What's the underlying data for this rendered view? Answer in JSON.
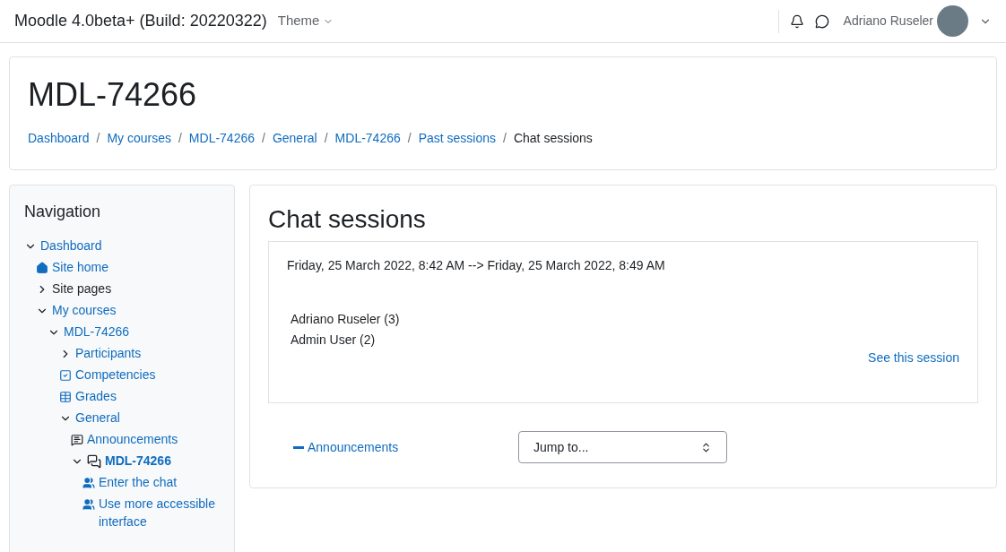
{
  "navbar": {
    "site_name": "Moodle 4.0beta+ (Build: 20220322)",
    "theme_menu": "Theme",
    "user_name": "Adriano Ruseler"
  },
  "header": {
    "title": "MDL-74266",
    "separator": "/",
    "breadcrumbs": [
      {
        "label": "Dashboard",
        "link": true
      },
      {
        "label": "My courses",
        "link": true
      },
      {
        "label": "MDL-74266",
        "link": true
      },
      {
        "label": "General",
        "link": true
      },
      {
        "label": "MDL-74266",
        "link": true
      },
      {
        "label": "Past sessions",
        "link": true
      },
      {
        "label": "Chat sessions",
        "link": false
      }
    ]
  },
  "navigation": {
    "title": "Navigation",
    "items": [
      {
        "label": "Dashboard",
        "kind": "expander",
        "expanded": true,
        "link": true,
        "current": false,
        "children": [
          {
            "label": "Site home",
            "kind": "home",
            "link": true,
            "current": false
          },
          {
            "label": "Site pages",
            "kind": "expander",
            "expanded": false,
            "link": false,
            "current": false
          },
          {
            "label": "My courses",
            "kind": "expander",
            "expanded": true,
            "link": true,
            "current": false,
            "children": [
              {
                "label": "MDL-74266",
                "kind": "expander",
                "expanded": true,
                "link": true,
                "current": false,
                "children": [
                  {
                    "label": "Participants",
                    "kind": "expander",
                    "expanded": false,
                    "link": true,
                    "current": false
                  },
                  {
                    "label": "Competencies",
                    "kind": "check",
                    "link": true,
                    "current": false
                  },
                  {
                    "label": "Grades",
                    "kind": "table",
                    "link": true,
                    "current": false
                  },
                  {
                    "label": "General",
                    "kind": "expander",
                    "expanded": true,
                    "link": true,
                    "current": false,
                    "children": [
                      {
                        "label": "Announcements",
                        "kind": "forum",
                        "link": true,
                        "current": false
                      },
                      {
                        "label": "MDL-74266",
                        "kind": "chat",
                        "expanded": true,
                        "link": true,
                        "current": true,
                        "children": [
                          {
                            "label": "Enter the chat",
                            "kind": "users",
                            "link": true,
                            "current": false
                          },
                          {
                            "label": "Use more accessible interface",
                            "kind": "users",
                            "link": true,
                            "current": false
                          }
                        ]
                      }
                    ]
                  }
                ]
              }
            ]
          }
        ]
      }
    ]
  },
  "main": {
    "title": "Chat sessions",
    "session": {
      "period": "Friday, 25 March 2022, 8:42 AM --> Friday, 25 March 2022, 8:49 AM",
      "participants": [
        "Adriano Ruseler (3)",
        "Admin User (2)"
      ],
      "link": "See this session"
    },
    "prev_link": "Announcements",
    "jump_select": {
      "value": "Jump to..."
    }
  }
}
